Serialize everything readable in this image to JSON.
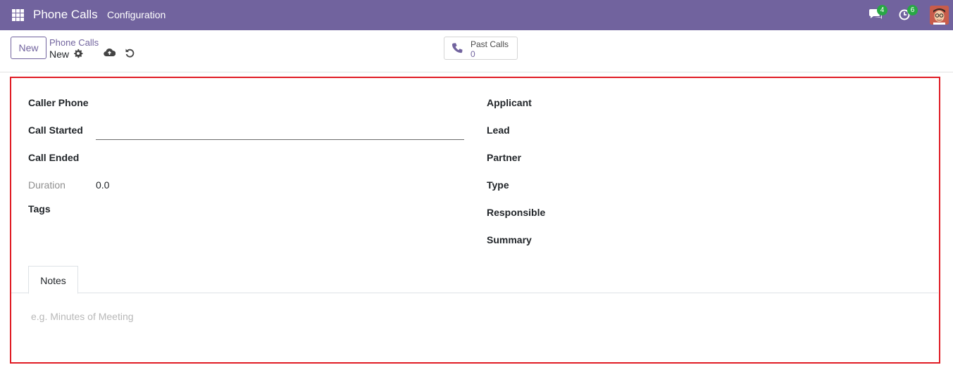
{
  "topbar": {
    "app_name": "Phone Calls",
    "menu_item": "Configuration",
    "chat_count": "4",
    "activity_count": "6",
    "accent": "#71639e",
    "badge_color": "#28a745"
  },
  "control": {
    "new_label": "New",
    "breadcrumb_parent": "Phone Calls",
    "breadcrumb_current": "New",
    "past_calls_label": "Past Calls",
    "past_calls_count": "0"
  },
  "form": {
    "left": {
      "caller_phone": "Caller Phone",
      "call_started": "Call Started",
      "call_ended": "Call Ended",
      "duration": "Duration",
      "duration_value": "0.0",
      "tags": "Tags"
    },
    "right": {
      "applicant": "Applicant",
      "lead": "Lead",
      "partner": "Partner",
      "type": "Type",
      "responsible": "Responsible",
      "summary": "Summary"
    },
    "tabs": {
      "notes": "Notes"
    },
    "notes_placeholder": "e.g. Minutes of Meeting",
    "highlight_color": "#e01b24"
  }
}
